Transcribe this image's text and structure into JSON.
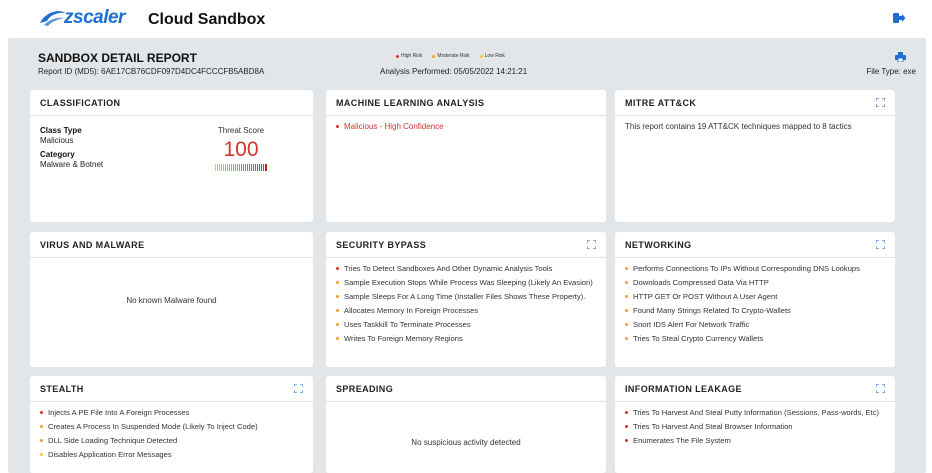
{
  "app": {
    "logo_text": "zscaler",
    "title": "Cloud Sandbox",
    "brand_color": "#1d6fd0"
  },
  "report": {
    "title": "SANDBOX DETAIL REPORT",
    "report_id": "Report ID (MD5): 6AE17CB76CDF097D4DC4FCCCFB5ABD8A",
    "analysis": "Analysis Performed: 05/05/2022 14:21:21",
    "file_type": "File Type: exe",
    "legend": [
      {
        "label": "High Risk",
        "color": "#d0342c"
      },
      {
        "label": "Moderate Risk",
        "color": "#f0a030"
      },
      {
        "label": "Low Risk",
        "color": "#f5c542"
      }
    ]
  },
  "classification": {
    "title": "CLASSIFICATION",
    "class_type_label": "Class Type",
    "class_type_value": "Malicious",
    "category_label": "Category",
    "category_value": "Malware & Botnet",
    "threat_score_label": "Threat Score",
    "threat_score_value": "100",
    "threat_score_fraction": 1.0
  },
  "ml": {
    "title": "MACHINE LEARNING ANALYSIS",
    "items": [
      {
        "text": "Malicious - High Confidence",
        "risk": "high"
      }
    ]
  },
  "mitre": {
    "title": "MITRE ATT&CK",
    "text": "This report contains 19 ATT&CK techniques mapped to 8 tactics"
  },
  "virus": {
    "title": "VIRUS AND MALWARE",
    "message": "No known Malware found"
  },
  "security_bypass": {
    "title": "SECURITY BYPASS",
    "items": [
      {
        "text": "Tries To Detect Sandboxes And Other Dynamic Analysis Tools",
        "risk": "high"
      },
      {
        "text": "Sample Execution Stops While Process Was Sleeping (Likely An Evasion)",
        "risk": "moderate"
      },
      {
        "text": "Sample Sleeps For A Long Time (Installer Files Shows These Property).",
        "risk": "moderate"
      },
      {
        "text": "Allocates Memory In Foreign Processes",
        "risk": "moderate"
      },
      {
        "text": "Uses Taskkill To Terminate Processes",
        "risk": "moderate"
      },
      {
        "text": "Writes To Foreign Memory Regions",
        "risk": "moderate"
      }
    ]
  },
  "networking": {
    "title": "NETWORKING",
    "items": [
      {
        "text": "Performs Connections To IPs Without Corresponding DNS Lookups",
        "risk": "moderate"
      },
      {
        "text": "Downloads Compressed Data Via HTTP",
        "risk": "moderate"
      },
      {
        "text": "HTTP GET Or POST Without A User Agent",
        "risk": "moderate"
      },
      {
        "text": "Found Many Strings Related To Crypto-Wallets",
        "risk": "moderate"
      },
      {
        "text": "Snort IDS Alert For Network Traffic",
        "risk": "moderate"
      },
      {
        "text": "Tries To Steal Crypto Currency Wallets",
        "risk": "moderate"
      }
    ]
  },
  "stealth": {
    "title": "STEALTH",
    "items": [
      {
        "text": "Injects A PE File Into A Foreign Processes",
        "risk": "high"
      },
      {
        "text": "Creates A Process In Suspended Mode (Likely To Inject Code)",
        "risk": "moderate"
      },
      {
        "text": "DLL Side Loading Technique Detected",
        "risk": "moderate"
      },
      {
        "text": "Disables Application Error Messages",
        "risk": "low"
      }
    ]
  },
  "spreading": {
    "title": "SPREADING",
    "message": "No suspicious activity detected"
  },
  "info_leak": {
    "title": "INFORMATION LEAKAGE",
    "items": [
      {
        "text": "Tries To Harvest And Steal Putty Information (Sessions, Pass-words, Etc)",
        "risk": "high"
      },
      {
        "text": "Tries To Harvest And Steal Browser Information",
        "risk": "high"
      },
      {
        "text": "Enumerates The File System",
        "risk": "high"
      }
    ]
  }
}
